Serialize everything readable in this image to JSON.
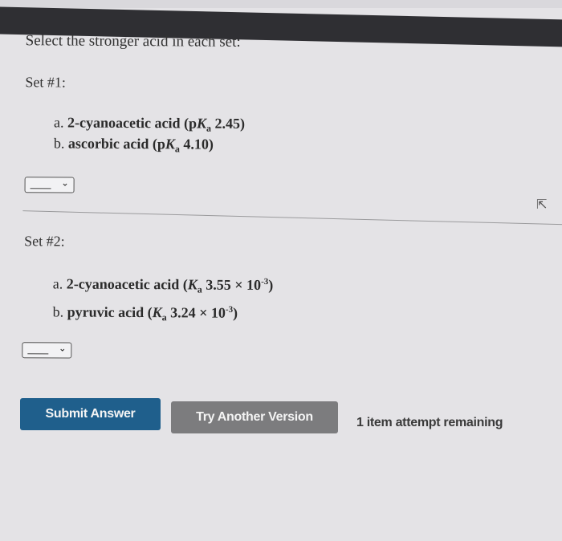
{
  "question": "Select the stronger acid in each set:",
  "sets": [
    {
      "label": "Set #1:",
      "options": [
        {
          "letter": "a.",
          "name": "2-cyanoacetic acid",
          "open": "(p",
          "K": "K",
          "sub": "a",
          "value": "2.45)",
          "exp": ""
        },
        {
          "letter": "b.",
          "name": "ascorbic acid",
          "open": "(p",
          "K": "K",
          "sub": "a",
          "value": "4.10)",
          "exp": ""
        }
      ],
      "select": {
        "value": "",
        "chevron": "⌄"
      }
    },
    {
      "label": "Set #2:",
      "options": [
        {
          "letter": "a.",
          "name": "2-cyanoacetic acid",
          "open": "(",
          "K": "K",
          "sub": "a",
          "value": "3.55 × 10",
          "exp": "-3",
          "close": ")"
        },
        {
          "letter": "b.",
          "name": "pyruvic acid",
          "open": "(",
          "K": "K",
          "sub": "a",
          "value": "3.24 × 10",
          "exp": "-3",
          "close": ")"
        }
      ],
      "select": {
        "value": "",
        "chevron": "⌄"
      }
    }
  ],
  "buttons": {
    "submit": "Submit Answer",
    "try_another": "Try Another Version"
  },
  "attempts_text": "1 item attempt remaining",
  "colors": {
    "submit_bg": "#1f5f8c",
    "try_bg": "#7c7c7e"
  }
}
